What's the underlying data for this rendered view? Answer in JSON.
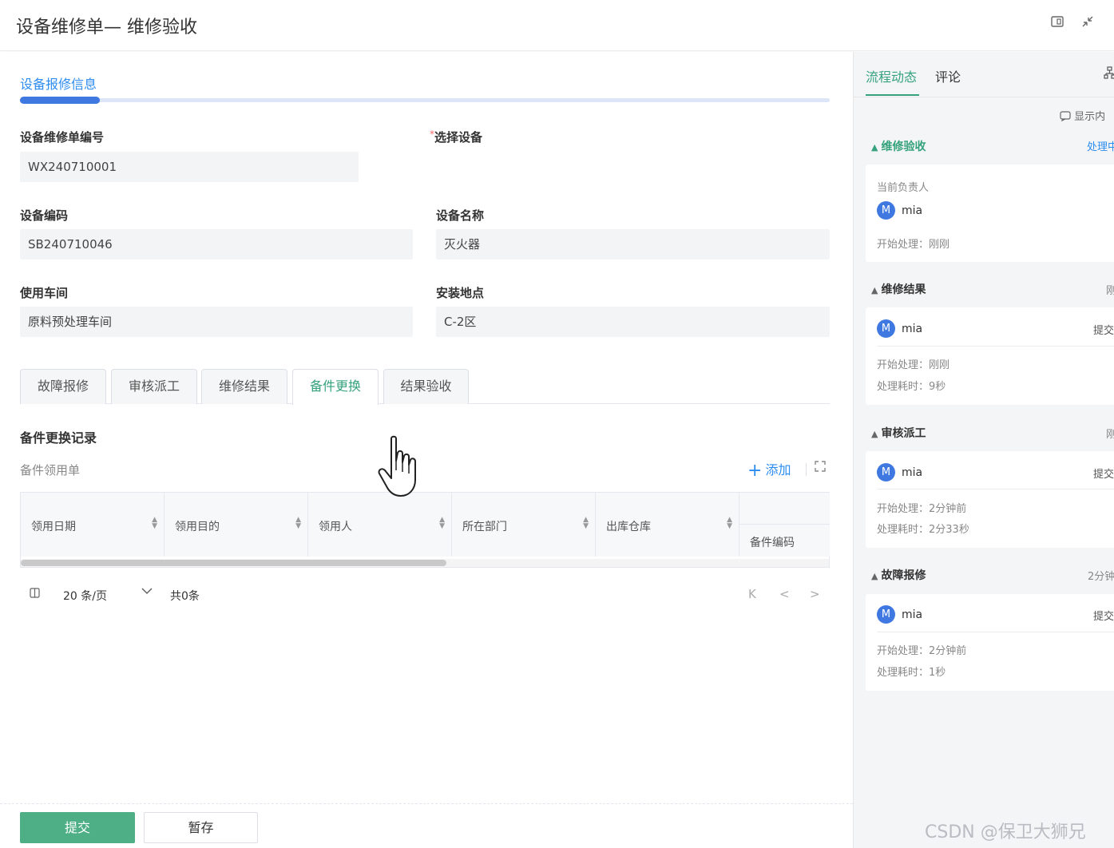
{
  "window": {
    "title": "设备维修单— 维修验收",
    "icons": [
      "expand-window-icon",
      "shrink-icon"
    ]
  },
  "form": {
    "section_tab": "设备报修信息",
    "fields": [
      {
        "label": "设备维修单编号",
        "value": "WX240710001",
        "required": false
      },
      {
        "label": "选择设备",
        "value": "",
        "required": true
      },
      {
        "label": "设备编码",
        "value": "SB240710046",
        "required": false
      },
      {
        "label": "设备名称",
        "value": "灭火器",
        "required": false
      },
      {
        "label": "使用车间",
        "value": "原料预处理车间",
        "required": false
      },
      {
        "label": "安装地点",
        "value": "C-2区",
        "required": false
      }
    ]
  },
  "tabs": [
    {
      "label": "故障报修",
      "active": false
    },
    {
      "label": "审核派工",
      "active": false
    },
    {
      "label": "维修结果",
      "active": false
    },
    {
      "label": "备件更换",
      "active": true
    },
    {
      "label": "结果验收",
      "active": false
    }
  ],
  "spare": {
    "title": "备件更换记录",
    "sub_label": "备件领用单",
    "add_label": "添加",
    "columns": [
      "领用日期",
      "领用目的",
      "领用人",
      "所在部门",
      "出库仓库",
      "备件编码"
    ],
    "rows": []
  },
  "pagination": {
    "page_size": "20 条/页",
    "total": "共0条",
    "nav": [
      "K",
      "<",
      ">"
    ]
  },
  "footer": {
    "submit_label": "提交",
    "save_label": "暂存"
  },
  "side": {
    "tabs": [
      "流程动态",
      "评论"
    ],
    "active_tab": "流程动态",
    "show_toggle": "显示内",
    "stages": [
      {
        "name": "维修验收",
        "status": "处理中",
        "current": true,
        "owner_label": "当前负责人",
        "user": "mia",
        "avatar": "M",
        "start": "开始处理：刚刚"
      },
      {
        "name": "维修结果",
        "status": "刚",
        "user": "mia",
        "avatar": "M",
        "action": "提交",
        "start": "开始处理：刚刚",
        "duration": "处理耗时：9秒"
      },
      {
        "name": "审核派工",
        "status": "刚",
        "user": "mia",
        "avatar": "M",
        "action": "提交",
        "start": "开始处理：2分钟前",
        "duration": "处理耗时：2分33秒"
      },
      {
        "name": "故障报修",
        "status": "2分钟",
        "user": "mia",
        "avatar": "M",
        "action": "提交",
        "start": "开始处理：2分钟前",
        "duration": "处理耗时：1秒"
      }
    ]
  },
  "watermark": "CSDN @保卫大狮兄",
  "colors": {
    "accent_green": "#4eaf86",
    "tab_active_green": "#35a27c",
    "link_blue": "#2d8cf0",
    "avatar_blue": "#3f78e0"
  }
}
